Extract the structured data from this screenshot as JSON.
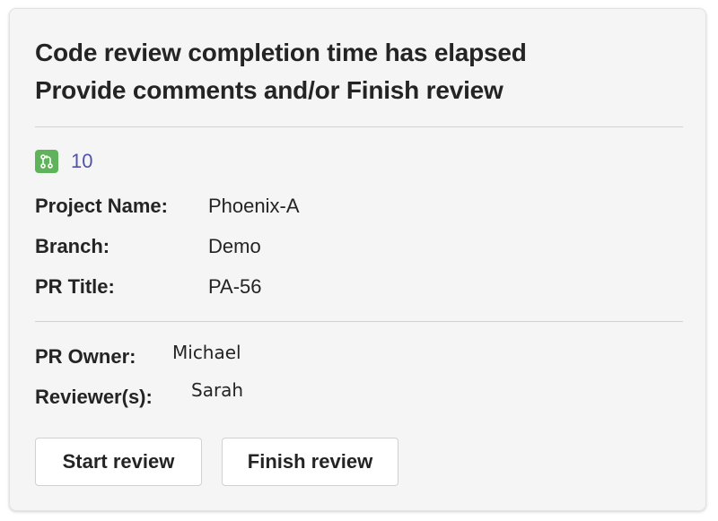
{
  "card": {
    "title_line1": "Code review completion time has elapsed",
    "title_line2": "Provide comments and/or Finish review",
    "pr_icon": "pull-request-icon",
    "pr_number": "10",
    "accent_color": "#4f52b2",
    "icon_color": "#5fb35a"
  },
  "details": {
    "project_label": "Project Name:",
    "project_value": "Phoenix-A",
    "branch_label": "Branch:",
    "branch_value": "Demo",
    "pr_title_label": "PR Title:",
    "pr_title_value": "PA-56"
  },
  "people": {
    "owner_label": "PR Owner:",
    "owner_value": "Michael",
    "reviewers_label": "Reviewer(s):",
    "reviewers_value": "Sarah"
  },
  "actions": {
    "start_label": "Start review",
    "finish_label": "Finish review"
  }
}
